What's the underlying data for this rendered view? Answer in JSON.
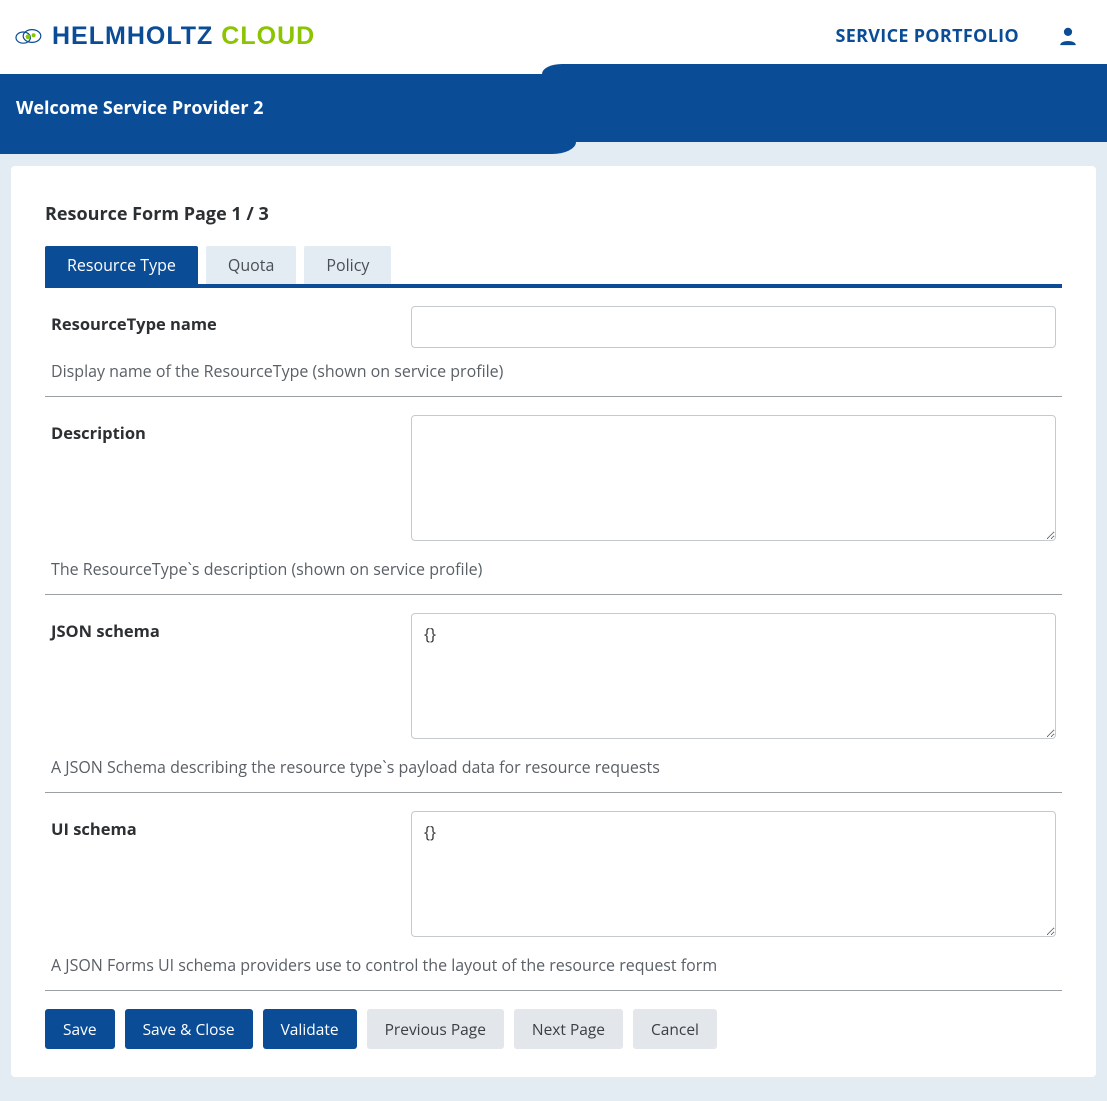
{
  "header": {
    "logo_part1": "HELMHOLTZ",
    "logo_part2": "CLOUD",
    "nav_portfolio": "SERVICE PORTFOLIO"
  },
  "subheader": {
    "welcome": "Welcome Service Provider 2"
  },
  "form": {
    "page_title": "Resource Form Page 1 / 3",
    "tabs": [
      {
        "label": "Resource Type"
      },
      {
        "label": "Quota"
      },
      {
        "label": "Policy"
      }
    ],
    "fields": {
      "name": {
        "label": "ResourceType name",
        "value": "",
        "help": "Display name of the ResourceType (shown on service profile)"
      },
      "description": {
        "label": "Description",
        "value": "",
        "help": "The ResourceType`s description (shown on service profile)"
      },
      "json_schema": {
        "label": "JSON schema",
        "value": "{}",
        "help": "A JSON Schema describing the resource type`s payload data for resource requests"
      },
      "ui_schema": {
        "label": "UI schema",
        "value": "{}",
        "help": "A JSON Forms UI schema providers use to control the layout of the resource request form"
      }
    },
    "buttons": {
      "save": "Save",
      "save_close": "Save & Close",
      "validate": "Validate",
      "prev": "Previous Page",
      "next": "Next Page",
      "cancel": "Cancel"
    }
  }
}
